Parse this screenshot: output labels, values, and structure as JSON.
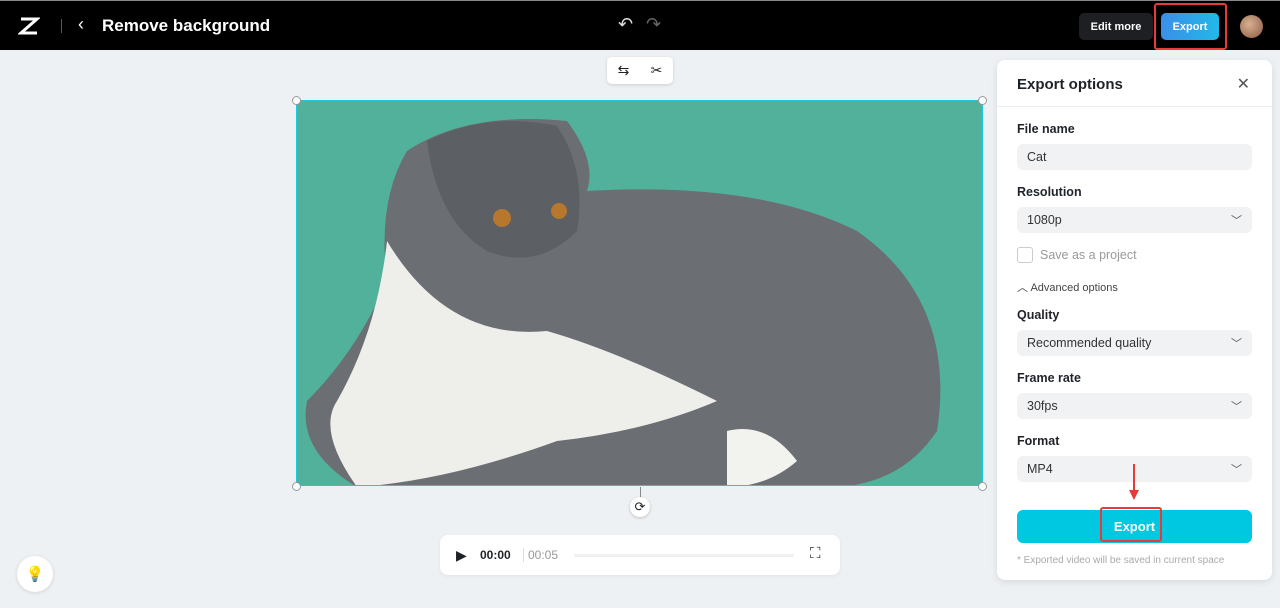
{
  "header": {
    "title": "Remove background",
    "edit_more": "Edit more",
    "export": "Export",
    "back_icon": "‹",
    "undo_icon": "↶",
    "redo_icon": "↷"
  },
  "toolbar": {
    "swap_icon": "⇆",
    "scissors_icon": "✂"
  },
  "player": {
    "current": "00:00",
    "duration": "00:05",
    "progress": 0
  },
  "panel": {
    "title": "Export options",
    "file_name_label": "File name",
    "file_name": "Cat",
    "resolution_label": "Resolution",
    "resolution": "1080p",
    "save_project": "Save as a project",
    "advanced": "Advanced options",
    "quality_label": "Quality",
    "quality": "Recommended quality",
    "frame_rate_label": "Frame rate",
    "frame_rate": "30fps",
    "format_label": "Format",
    "format": "MP4",
    "export": "Export",
    "note": "* Exported video will be saved in current space"
  },
  "colors": {
    "accent": "#00c8e0",
    "canvas_bg": "#52b19b",
    "highlight": "#e83a3a"
  }
}
